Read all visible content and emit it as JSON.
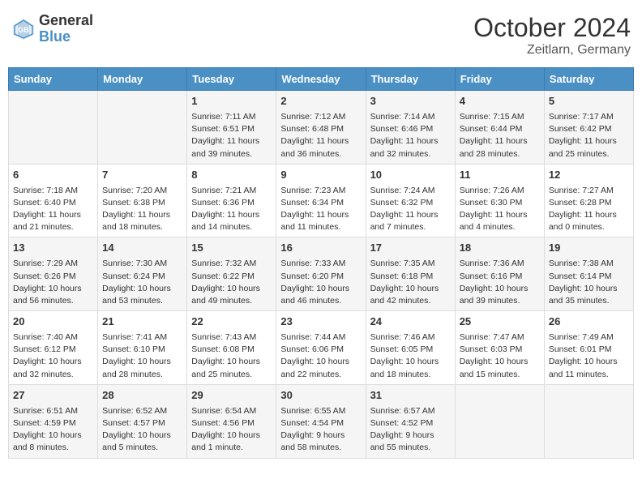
{
  "header": {
    "logo_general": "General",
    "logo_blue": "Blue",
    "month": "October 2024",
    "location": "Zeitlarn, Germany"
  },
  "weekdays": [
    "Sunday",
    "Monday",
    "Tuesday",
    "Wednesday",
    "Thursday",
    "Friday",
    "Saturday"
  ],
  "weeks": [
    [
      {
        "day": "",
        "content": ""
      },
      {
        "day": "",
        "content": ""
      },
      {
        "day": "1",
        "content": "Sunrise: 7:11 AM\nSunset: 6:51 PM\nDaylight: 11 hours and 39 minutes."
      },
      {
        "day": "2",
        "content": "Sunrise: 7:12 AM\nSunset: 6:48 PM\nDaylight: 11 hours and 36 minutes."
      },
      {
        "day": "3",
        "content": "Sunrise: 7:14 AM\nSunset: 6:46 PM\nDaylight: 11 hours and 32 minutes."
      },
      {
        "day": "4",
        "content": "Sunrise: 7:15 AM\nSunset: 6:44 PM\nDaylight: 11 hours and 28 minutes."
      },
      {
        "day": "5",
        "content": "Sunrise: 7:17 AM\nSunset: 6:42 PM\nDaylight: 11 hours and 25 minutes."
      }
    ],
    [
      {
        "day": "6",
        "content": "Sunrise: 7:18 AM\nSunset: 6:40 PM\nDaylight: 11 hours and 21 minutes."
      },
      {
        "day": "7",
        "content": "Sunrise: 7:20 AM\nSunset: 6:38 PM\nDaylight: 11 hours and 18 minutes."
      },
      {
        "day": "8",
        "content": "Sunrise: 7:21 AM\nSunset: 6:36 PM\nDaylight: 11 hours and 14 minutes."
      },
      {
        "day": "9",
        "content": "Sunrise: 7:23 AM\nSunset: 6:34 PM\nDaylight: 11 hours and 11 minutes."
      },
      {
        "day": "10",
        "content": "Sunrise: 7:24 AM\nSunset: 6:32 PM\nDaylight: 11 hours and 7 minutes."
      },
      {
        "day": "11",
        "content": "Sunrise: 7:26 AM\nSunset: 6:30 PM\nDaylight: 11 hours and 4 minutes."
      },
      {
        "day": "12",
        "content": "Sunrise: 7:27 AM\nSunset: 6:28 PM\nDaylight: 11 hours and 0 minutes."
      }
    ],
    [
      {
        "day": "13",
        "content": "Sunrise: 7:29 AM\nSunset: 6:26 PM\nDaylight: 10 hours and 56 minutes."
      },
      {
        "day": "14",
        "content": "Sunrise: 7:30 AM\nSunset: 6:24 PM\nDaylight: 10 hours and 53 minutes."
      },
      {
        "day": "15",
        "content": "Sunrise: 7:32 AM\nSunset: 6:22 PM\nDaylight: 10 hours and 49 minutes."
      },
      {
        "day": "16",
        "content": "Sunrise: 7:33 AM\nSunset: 6:20 PM\nDaylight: 10 hours and 46 minutes."
      },
      {
        "day": "17",
        "content": "Sunrise: 7:35 AM\nSunset: 6:18 PM\nDaylight: 10 hours and 42 minutes."
      },
      {
        "day": "18",
        "content": "Sunrise: 7:36 AM\nSunset: 6:16 PM\nDaylight: 10 hours and 39 minutes."
      },
      {
        "day": "19",
        "content": "Sunrise: 7:38 AM\nSunset: 6:14 PM\nDaylight: 10 hours and 35 minutes."
      }
    ],
    [
      {
        "day": "20",
        "content": "Sunrise: 7:40 AM\nSunset: 6:12 PM\nDaylight: 10 hours and 32 minutes."
      },
      {
        "day": "21",
        "content": "Sunrise: 7:41 AM\nSunset: 6:10 PM\nDaylight: 10 hours and 28 minutes."
      },
      {
        "day": "22",
        "content": "Sunrise: 7:43 AM\nSunset: 6:08 PM\nDaylight: 10 hours and 25 minutes."
      },
      {
        "day": "23",
        "content": "Sunrise: 7:44 AM\nSunset: 6:06 PM\nDaylight: 10 hours and 22 minutes."
      },
      {
        "day": "24",
        "content": "Sunrise: 7:46 AM\nSunset: 6:05 PM\nDaylight: 10 hours and 18 minutes."
      },
      {
        "day": "25",
        "content": "Sunrise: 7:47 AM\nSunset: 6:03 PM\nDaylight: 10 hours and 15 minutes."
      },
      {
        "day": "26",
        "content": "Sunrise: 7:49 AM\nSunset: 6:01 PM\nDaylight: 10 hours and 11 minutes."
      }
    ],
    [
      {
        "day": "27",
        "content": "Sunrise: 6:51 AM\nSunset: 4:59 PM\nDaylight: 10 hours and 8 minutes."
      },
      {
        "day": "28",
        "content": "Sunrise: 6:52 AM\nSunset: 4:57 PM\nDaylight: 10 hours and 5 minutes."
      },
      {
        "day": "29",
        "content": "Sunrise: 6:54 AM\nSunset: 4:56 PM\nDaylight: 10 hours and 1 minute."
      },
      {
        "day": "30",
        "content": "Sunrise: 6:55 AM\nSunset: 4:54 PM\nDaylight: 9 hours and 58 minutes."
      },
      {
        "day": "31",
        "content": "Sunrise: 6:57 AM\nSunset: 4:52 PM\nDaylight: 9 hours and 55 minutes."
      },
      {
        "day": "",
        "content": ""
      },
      {
        "day": "",
        "content": ""
      }
    ]
  ]
}
